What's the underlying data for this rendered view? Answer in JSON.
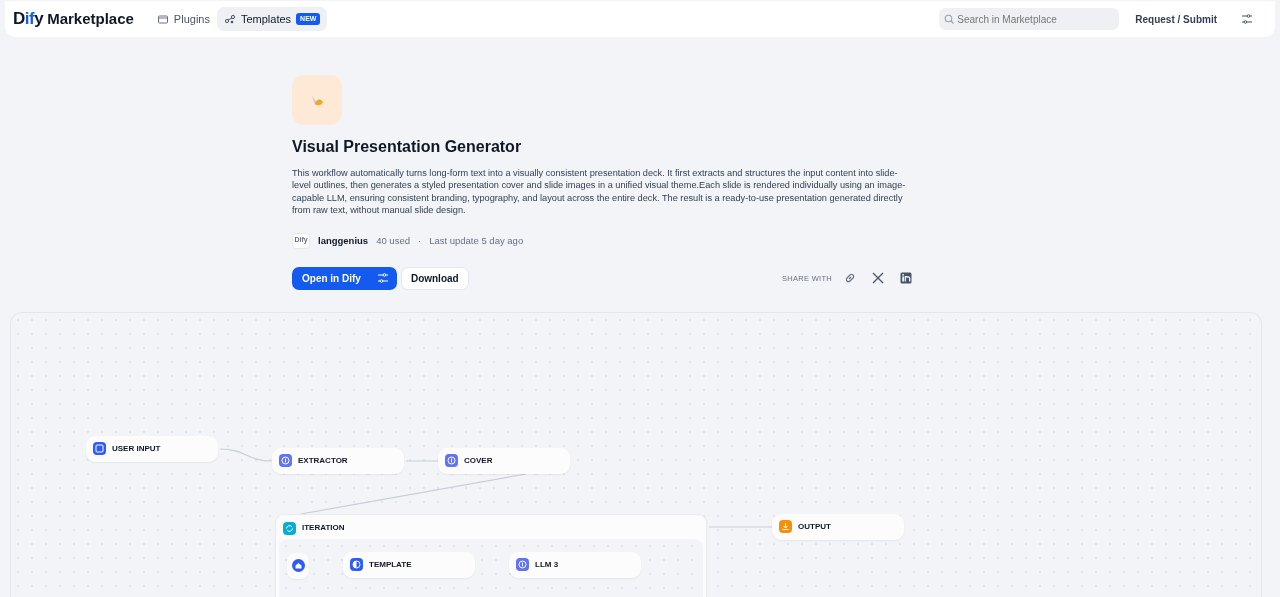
{
  "header": {
    "logo": [
      {
        "text": "D",
        "accent": false
      },
      {
        "text": "if",
        "accent": true
      },
      {
        "text": "y",
        "accent": false
      }
    ],
    "brand": "Marketplace",
    "tabs": [
      {
        "label": "Plugins",
        "selected": false,
        "kind": "plugins"
      },
      {
        "label": "Templates",
        "selected": true,
        "kind": "templates",
        "badge": "NEW"
      }
    ],
    "search": {
      "placeholder": "Search in Marketplace"
    },
    "request_link": "Request / Submit"
  },
  "template": {
    "title": "Visual Presentation Generator",
    "description": "This workflow automatically turns long-form text into a visually consistent presentation deck. It first extracts and structures the input content into slide-level outlines, then generates a styled presentation cover and slide images in a unified visual theme.Each slide is rendered individually using an image-capable LLM, ensuring consistent branding, typography, and layout across the entire deck. The result is a ready-to-use presentation generated directly from raw text, without manual slide design.",
    "author_logo": "Dify",
    "author": "langgenius",
    "usage": "40 used",
    "separator": "·",
    "updated": "Last update 5 day ago",
    "primary_button": "Open in Dify",
    "secondary_button": "Download",
    "share_label": "SHARE WITH"
  },
  "workflow": {
    "nodes": [
      {
        "label": "USER INPUT",
        "kind": "start"
      },
      {
        "label": "EXTRACTOR",
        "kind": "llm"
      },
      {
        "label": "COVER",
        "kind": "llm"
      },
      {
        "label": "ITERATION",
        "kind": "iteration",
        "children": [
          {
            "kind": "iteration-start"
          },
          {
            "label": "TEMPLATE",
            "kind": "template"
          },
          {
            "label": "LLM 3",
            "kind": "llm"
          }
        ]
      },
      {
        "label": "OUTPUT",
        "kind": "output"
      }
    ]
  }
}
